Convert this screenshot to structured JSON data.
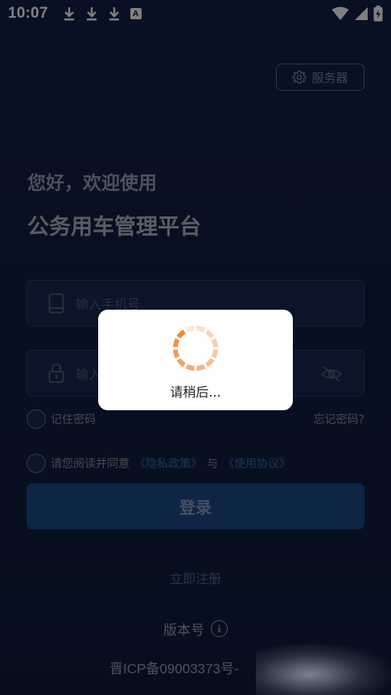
{
  "status_bar": {
    "time": "10:07",
    "left_icons": [
      "download-icon",
      "download-icon",
      "download-icon",
      "a-badge-icon"
    ],
    "a_badge": "A",
    "right_icons": [
      "wifi-icon",
      "signal-icon",
      "battery-charging-icon"
    ]
  },
  "header": {
    "server_button_label": "服务器",
    "greeting": "您好，欢迎使用",
    "title": "公务用车管理平台"
  },
  "form": {
    "phone_placeholder": "输入手机号",
    "password_placeholder": "输入密码",
    "remember_label": "记住密码",
    "forgot_label": "忘记密码?",
    "agreement_prefix": "请您阅读并同意",
    "privacy_link": "《隐私政策》",
    "agreement_and": "与",
    "terms_link": "《使用协议》",
    "login_label": "登录",
    "register_label": "立即注册"
  },
  "footer": {
    "version_label": "版本号",
    "icp_text": "晋ICP备09003373号-"
  },
  "loading_dialog": {
    "message": "请稍后..."
  },
  "colors": {
    "background": "#0f2043",
    "accent": "#1e4a8a",
    "link": "#3a6bb5",
    "spinner": "#f08a3c"
  }
}
